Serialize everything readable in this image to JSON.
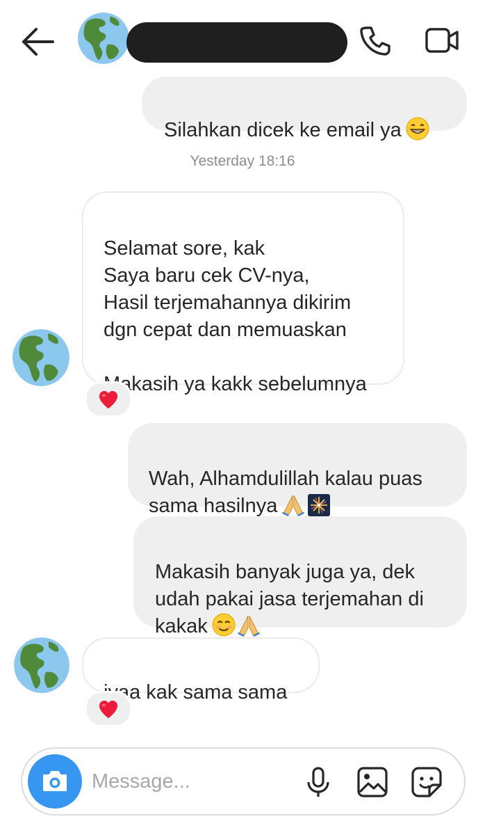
{
  "header": {
    "back_icon": "arrow-left-icon",
    "contact_avatar_icon": "globe-americas-icon",
    "contact_name_redacted": true,
    "call_icon": "phone-icon",
    "video_icon": "video-camera-icon"
  },
  "messages": [
    {
      "direction": "outgoing",
      "text": "Silahkan dicek ke email ya",
      "emoji": [
        "grinning-face"
      ]
    },
    {
      "type": "timestamp",
      "text": "Yesterday 18:16"
    },
    {
      "direction": "incoming",
      "text": "Selamat sore, kak\nSaya baru cek CV-nya,\nHasil terjemahannya dikirim\ndgn cepat dan memuaskan\n\nMakasih ya kakk sebelumnya",
      "reaction": "red-heart"
    },
    {
      "direction": "outgoing",
      "text": "Wah, Alhamdulillah kalau puas\nsama hasilnya",
      "emoji": [
        "folded-hands",
        "fireworks"
      ]
    },
    {
      "direction": "outgoing",
      "text": "Makasih banyak juga ya, dek\nudah pakai jasa terjemahan di\nkakak",
      "emoji": [
        "smiling-face",
        "folded-hands"
      ]
    },
    {
      "direction": "incoming",
      "text": "iyaa kak sama sama",
      "reaction": "red-heart"
    }
  ],
  "composer": {
    "placeholder": "Message...",
    "camera_icon": "camera-icon",
    "mic_icon": "microphone-icon",
    "gallery_icon": "image-icon",
    "sticker_icon": "sticker-icon"
  },
  "colors": {
    "accent": "#3797f0",
    "outgoing_bubble": "#efefef",
    "incoming_border": "#ebebeb",
    "timestamp": "#8e8e8e",
    "heart": "#ed1c3a"
  }
}
